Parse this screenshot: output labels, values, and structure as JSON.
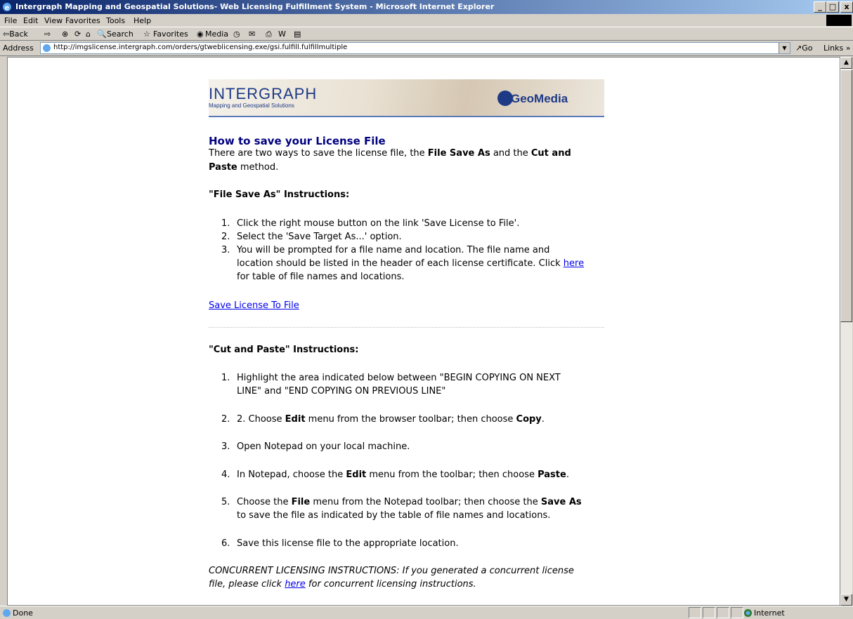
{
  "window": {
    "title": "Intergraph Mapping and Geospatial Solutions- Web Licensing Fulfillment System - Microsoft Internet Explorer",
    "min": "_",
    "max": "□",
    "close": "x"
  },
  "menu": [
    "File",
    "Edit",
    "View",
    "Favorites",
    "Tools",
    "Help"
  ],
  "toolbar": {
    "back": "⇦Back",
    "forward": "⇨",
    "stop": "⊗",
    "refresh": "⟳",
    "home": "⌂",
    "search": "Search",
    "favorites": "Favorites",
    "media": "Media",
    "history": "◷",
    "mail": "✉",
    "print": "⎙",
    "edit": "W",
    "discuss": "▤"
  },
  "address": {
    "label": "Address",
    "url": "http://imgslicense.intergraph.com/orders/gtweblicensing.exe/gsi.fulfill.fulfillmultiple",
    "go": "Go",
    "links": "Links »"
  },
  "banner": {
    "logo": "INTERGRAPH",
    "tagline": "Mapping and Geospatial Solutions",
    "product": "GeoMedia"
  },
  "page": {
    "heading": "How to save your License File",
    "intro_1a": "There are two ways to save the license file, the ",
    "intro_1b": "File Save As",
    "intro_1c": " and the ",
    "intro_1d": "Cut and",
    "intro_2a": "Paste",
    "intro_2b": " method.",
    "fsa_heading": "\"File Save As\" Instructions:",
    "fsa_items": [
      {
        "num": "1.",
        "text": "Click the right mouse button on the link 'Save License to File'."
      },
      {
        "num": "2.",
        "text": "Select the 'Save Target As...' option."
      },
      {
        "num": "3.",
        "text": "You will be prompted for a file name and location. The file name and"
      }
    ],
    "fsa_3_line2a": "location should be listed in the header of each license certificate. Click ",
    "fsa_3_link": "here",
    "fsa_3_line3": "for table of file names and locations.",
    "save_link": "Save License To File",
    "cp_heading": "\"Cut and Paste\" Instructions:",
    "cp_1_num": "1.",
    "cp_1_line1": "Highlight the area indicated below between \"BEGIN COPYING ON NEXT",
    "cp_1_line2": "LINE\" and \"END COPYING ON PREVIOUS LINE\"",
    "cp_2_num": "2.",
    "cp_2_a": "2. Choose ",
    "cp_2_b": "Edit",
    "cp_2_c": " menu from the browser toolbar; then choose ",
    "cp_2_d": "Copy",
    "cp_2_e": ".",
    "cp_3_num": "3.",
    "cp_3": "Open Notepad on your local machine.",
    "cp_4_num": "4.",
    "cp_4_a": "In Notepad, choose the ",
    "cp_4_b": "Edit",
    "cp_4_c": " menu from the toolbar; then choose ",
    "cp_4_d": "Paste",
    "cp_4_e": ".",
    "cp_5_num": "5.",
    "cp_5_a": "Choose the ",
    "cp_5_b": "File",
    "cp_5_c": " menu from the Notepad toolbar; then choose the ",
    "cp_5_d": "Save As",
    "cp_5_line2": "to save the file as indicated by the table of file names and locations.",
    "cp_6_num": "6.",
    "cp_6": "Save this license file to the appropriate location.",
    "concurrent_line1": "CONCURRENT LICENSING INSTRUCTIONS: If you generated a concurrent license",
    "concurrent_line2a": "file, please click ",
    "concurrent_link": "here",
    "concurrent_line2b": " for concurrent licensing instructions."
  },
  "status": {
    "text": "Done",
    "zone": "Internet"
  }
}
